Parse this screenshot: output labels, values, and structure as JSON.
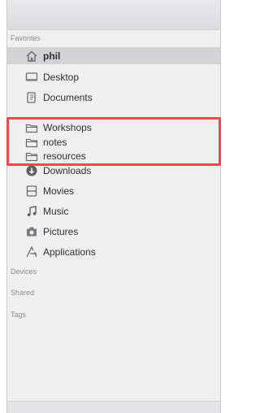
{
  "sidebar": {
    "favorites_header": "Favorites",
    "favorites": [
      {
        "label": "phil",
        "icon": "home-icon",
        "selected": true
      },
      {
        "label": "Desktop",
        "icon": "desktop-icon"
      },
      {
        "label": "Documents",
        "icon": "documents-icon"
      },
      {
        "label": "Workshops",
        "icon": "folder-icon"
      },
      {
        "label": "notes",
        "icon": "folder-icon"
      },
      {
        "label": "resources",
        "icon": "folder-icon"
      },
      {
        "label": "Downloads",
        "icon": "downloads-icon"
      },
      {
        "label": "Movies",
        "icon": "movies-icon"
      },
      {
        "label": "Music",
        "icon": "music-icon"
      },
      {
        "label": "Pictures",
        "icon": "pictures-icon"
      },
      {
        "label": "Applications",
        "icon": "applications-icon"
      }
    ],
    "devices_header": "Devices",
    "shared_header": "Shared",
    "tags_header": "Tags"
  },
  "highlight": {
    "color": "#ea4a4a",
    "items": [
      "Workshops",
      "notes",
      "resources"
    ]
  }
}
